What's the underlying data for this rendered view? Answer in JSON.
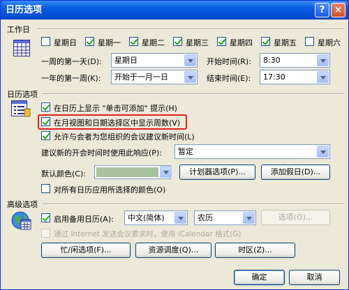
{
  "window": {
    "title": "日历选项",
    "help_glyph": "?",
    "close_glyph": "×"
  },
  "work_week": {
    "label": "工作日",
    "days": [
      {
        "label": "星期日",
        "checked": false
      },
      {
        "label": "星期一",
        "checked": true
      },
      {
        "label": "星期二",
        "checked": true
      },
      {
        "label": "星期三",
        "checked": true
      },
      {
        "label": "星期四",
        "checked": true
      },
      {
        "label": "星期五",
        "checked": true
      },
      {
        "label": "星期六",
        "checked": false
      }
    ],
    "first_day_label": "一周的第一天(D):",
    "first_day_value": "星期日",
    "first_week_label": "一年的第一周(K):",
    "first_week_value": "开始于一月一日",
    "start_time_label": "开始时间(R):",
    "start_time_value": "8:30",
    "end_time_label": "结束时间(E):",
    "end_time_value": "17:30"
  },
  "calendar_options": {
    "label": "日历选项",
    "show_click_to_add": {
      "label": "在日历上显示 \"单击可添加\" 提示(H)",
      "checked": true
    },
    "show_week_numbers": {
      "label": "在月视图和日期选择区中显示周数(V)",
      "checked": true
    },
    "allow_new_time": {
      "label": "允许与会者为您组织的会议建议新时间(L)",
      "checked": true
    },
    "respond_label": "建议新的开会时间时使用此响应(P):",
    "respond_value": "暂定",
    "default_color_label": "默认颜色(C):",
    "default_color_hex": "#a7c39d",
    "planner_button": "计划器选项(P)...",
    "holidays_button": "添加假日(D)...",
    "apply_color_all": {
      "label": "对所有日历应用所选择的颜色(O)",
      "checked": false
    }
  },
  "advanced": {
    "label": "高级选项",
    "alt_calendar": {
      "label": "启用备用日历(A):",
      "checked": true
    },
    "language_value": "中文(简体)",
    "calendar_type_value": "农历",
    "options_button": "选项(O)...",
    "icalendar": {
      "label": "通过 Internet 发送会议要求时，使用 iCalendar 格式(G)",
      "checked": false
    },
    "free_busy_button": "忙/闲选项(F)...",
    "resource_button": "资源调度(Q)...",
    "timezone_button": "时区(Z)..."
  },
  "footer": {
    "ok": "确定",
    "cancel": "取消"
  }
}
